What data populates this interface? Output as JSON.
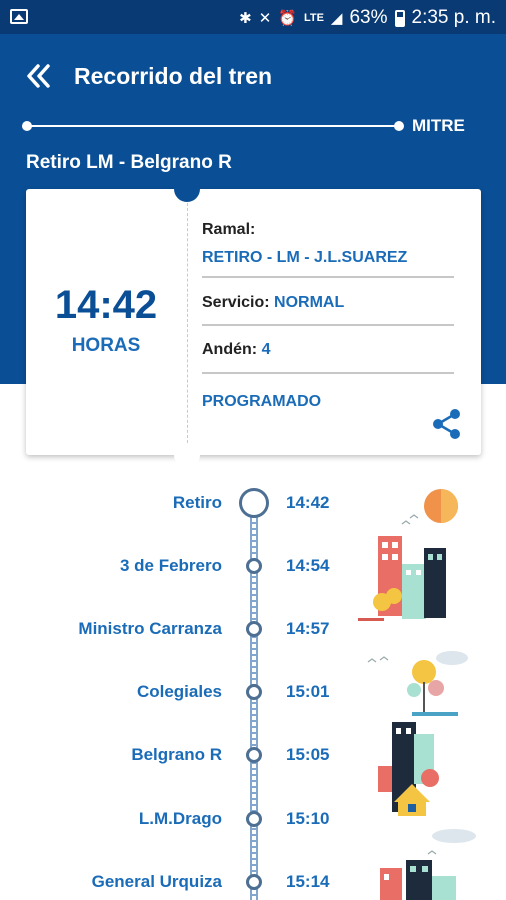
{
  "status": {
    "network": "LTE",
    "battery_percent": "63%",
    "time": "2:35 p. m."
  },
  "header": {
    "title": "Recorrido del tren",
    "line_name": "MITRE",
    "route": "Retiro LM - Belgrano R"
  },
  "card": {
    "time": "14:42",
    "time_unit": "HORAS",
    "ramal_label": "Ramal:",
    "ramal_value": "RETIRO - LM - J.L.SUAREZ",
    "servicio_label": "Servicio:",
    "servicio_value": "NORMAL",
    "anden_label": "Andén:",
    "anden_value": "4",
    "status": "PROGRAMADO"
  },
  "stops": [
    {
      "name": "Retiro",
      "time": "14:42"
    },
    {
      "name": "3 de Febrero",
      "time": "14:54"
    },
    {
      "name": "Ministro Carranza",
      "time": "14:57"
    },
    {
      "name": "Colegiales",
      "time": "15:01"
    },
    {
      "name": "Belgrano R",
      "time": "15:05"
    },
    {
      "name": "L.M.Drago",
      "time": "15:10"
    },
    {
      "name": "General Urquiza",
      "time": "15:14"
    }
  ],
  "colors": {
    "header_blue": "#0a4f95",
    "status_bar": "#0a3a74",
    "accent_text": "#1b6cb8"
  },
  "icons": {
    "back": "double-chevron-left-icon",
    "share": "share-icon"
  }
}
